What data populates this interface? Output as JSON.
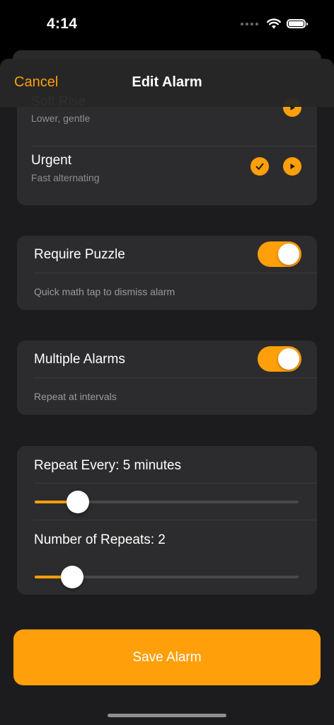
{
  "status_bar": {
    "time": "4:14"
  },
  "nav": {
    "cancel_label": "Cancel",
    "title": "Edit Alarm"
  },
  "sounds": [
    {
      "name": "Soft Rise",
      "description": "Lower, gentle",
      "selected": false
    },
    {
      "name": "Urgent",
      "description": "Fast alternating",
      "selected": true
    }
  ],
  "puzzle": {
    "label": "Require Puzzle",
    "enabled": true,
    "description": "Quick math tap to dismiss alarm"
  },
  "multiple": {
    "label": "Multiple Alarms",
    "enabled": true,
    "description": "Repeat at intervals"
  },
  "repeat_every": {
    "label": "Repeat Every: 5 minutes",
    "value": 5
  },
  "repeat_count": {
    "label": "Number of Repeats: 2",
    "value": 2
  },
  "save_label": "Save Alarm",
  "colors": {
    "accent": "#ff9f0a",
    "background": "#1c1c1e",
    "card": "#2c2c2e"
  },
  "icons": {
    "play": "play-icon",
    "check": "checkmark-icon",
    "wifi": "wifi-icon",
    "battery": "battery-icon",
    "signal": "cellular-signal-icon"
  }
}
